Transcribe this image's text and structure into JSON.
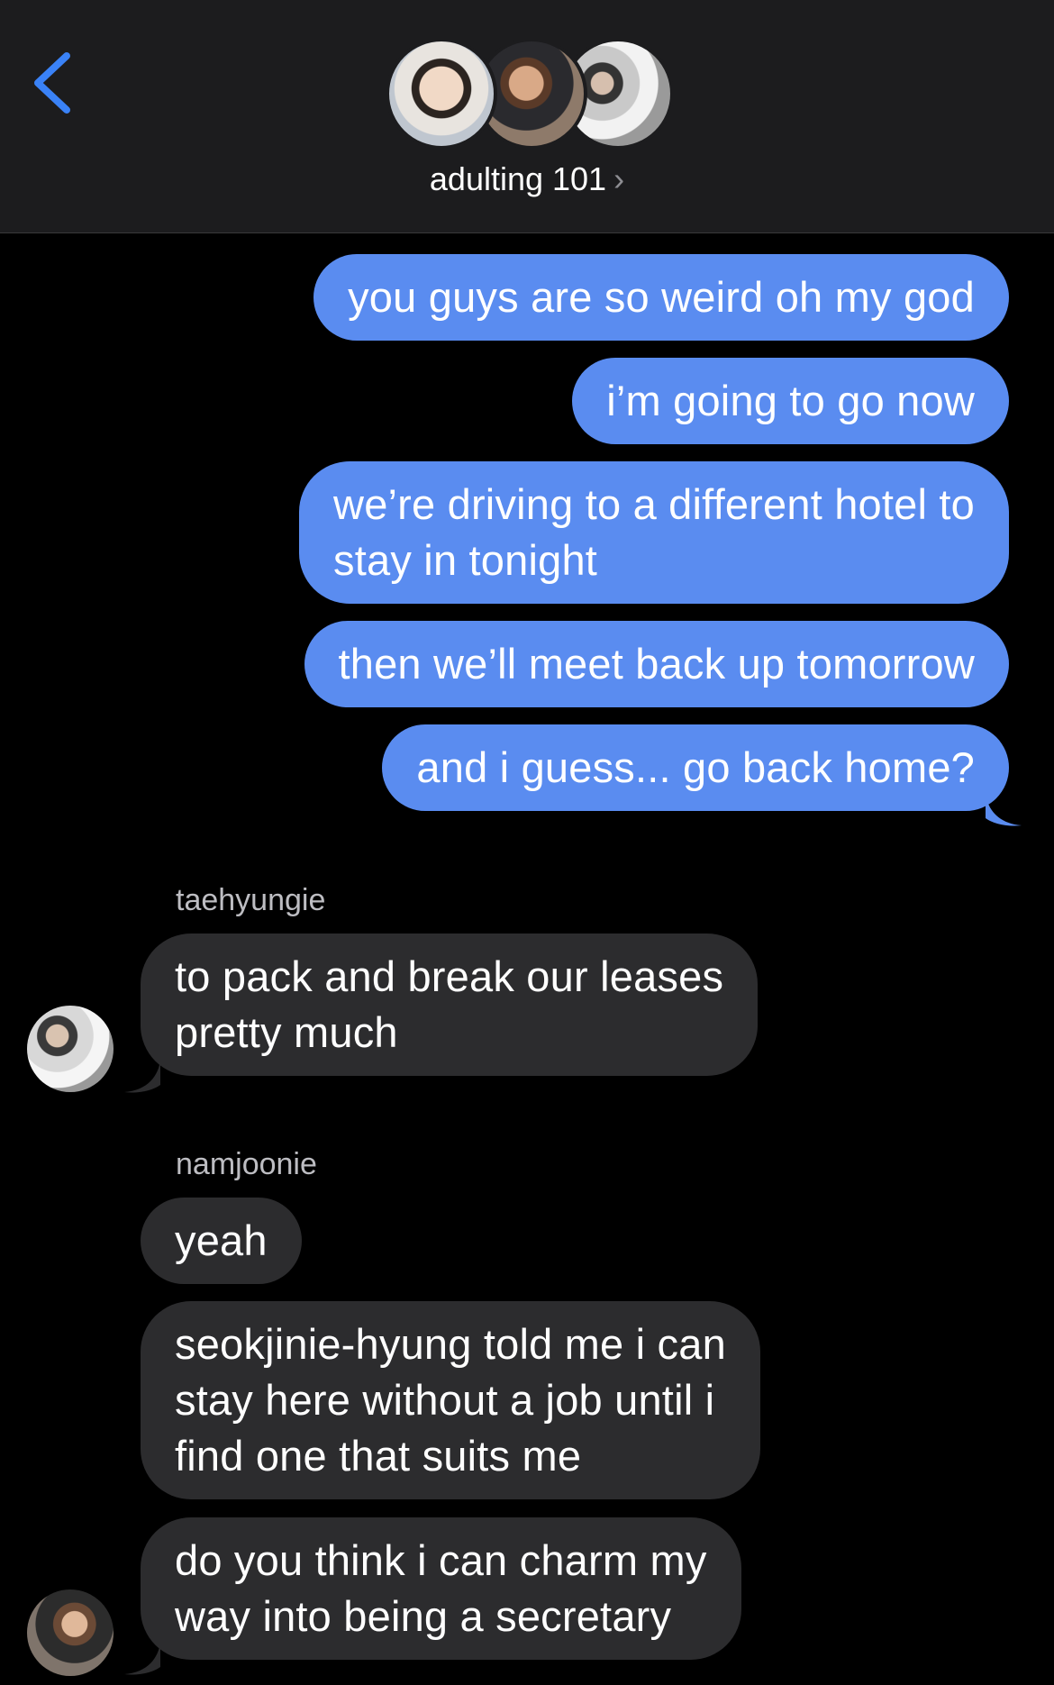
{
  "header": {
    "back_label": "",
    "group_name": "adulting 101",
    "chevron": "›",
    "avatars": [
      "avatar-1",
      "avatar-2",
      "avatar-3"
    ]
  },
  "colors": {
    "outgoing": "#5a8cf0",
    "incoming": "#2c2c2e",
    "header_bg": "#1c1c1e",
    "back_icon": "#3a82f7"
  },
  "messages": {
    "out": [
      "you guys are so weird oh my god",
      "i’m going to go now",
      [
        "we’re driving to a different hotel to",
        "stay in tonight"
      ],
      "then we’ll meet back up tomorrow",
      "and i guess... go back home?"
    ],
    "sender1": "taehyungie",
    "in1": [
      "to pack and break our leases",
      "pretty much"
    ],
    "sender2": "namjoonie",
    "in2": "yeah",
    "in3": [
      "seokjinie-hyung told me i can",
      "stay here without a job until i",
      "find one that suits me"
    ],
    "in4": [
      "do you think i can charm my",
      "way into being a secretary"
    ]
  }
}
